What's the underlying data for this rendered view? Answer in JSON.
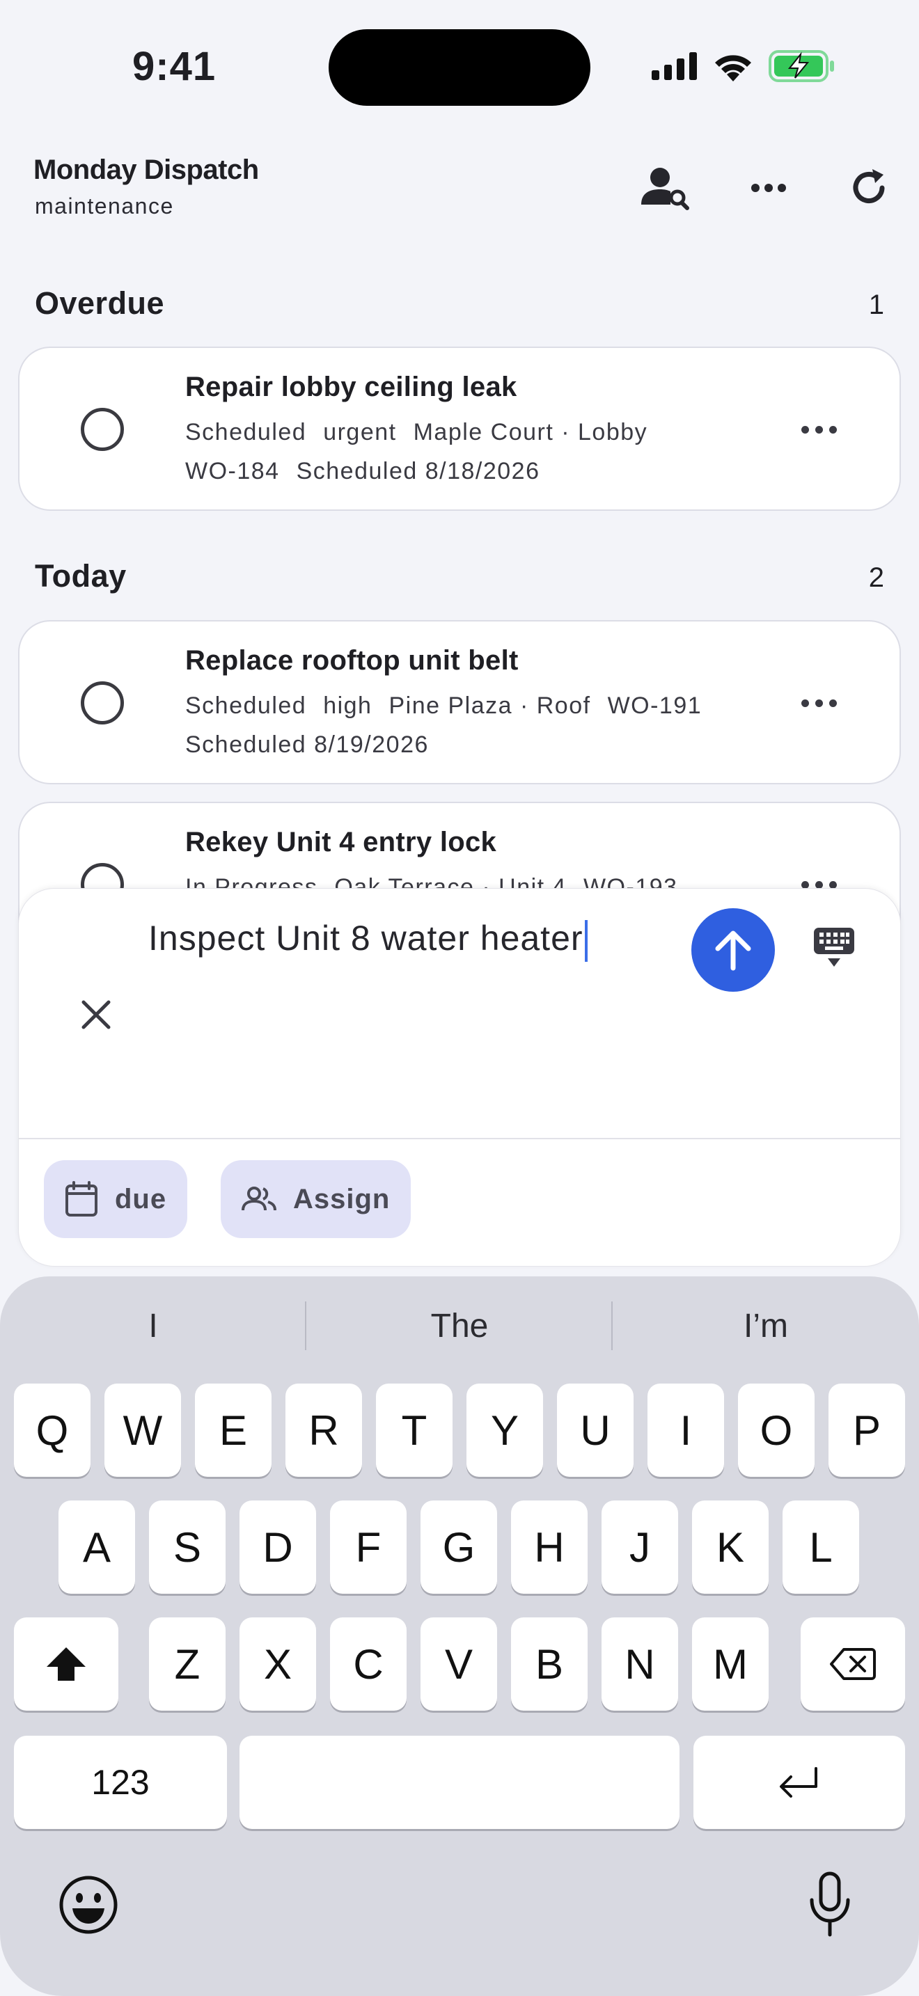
{
  "status_bar": {
    "time": "9:41"
  },
  "header": {
    "title": "Monday Dispatch",
    "subtitle": "maintenance",
    "icons": [
      "user-search-icon",
      "more-horizontal-icon",
      "refresh-icon"
    ]
  },
  "sections": [
    {
      "title": "Overdue",
      "count": "1",
      "items": [
        {
          "title": "Repair lobby ceiling leak",
          "meta_line1": [
            "Scheduled",
            "urgent",
            "Maple Court · Lobby"
          ],
          "meta_line2": [
            "WO-184",
            "Scheduled 8/18/2026"
          ]
        }
      ]
    },
    {
      "title": "Today",
      "count": "2",
      "items": [
        {
          "title": "Replace rooftop unit belt",
          "meta_line1": [
            "Scheduled",
            "high",
            "Pine Plaza · Roof",
            "WO-191"
          ],
          "meta_line2": [
            "Scheduled 8/19/2026"
          ]
        },
        {
          "title": "Rekey Unit 4 entry lock",
          "meta_line1": [
            "In Progress",
            "Oak Terrace · Unit 4",
            "WO-193"
          ],
          "meta_line2": []
        }
      ]
    }
  ],
  "composer": {
    "input_value": "Inspect Unit 8 water heater",
    "chips": [
      "due",
      "Assign"
    ],
    "accent_color": "#2f5fe0"
  },
  "keyboard": {
    "suggestions": [
      "I",
      "The",
      "I’m"
    ],
    "row1": [
      "Q",
      "W",
      "E",
      "R",
      "T",
      "Y",
      "U",
      "I",
      "O",
      "P"
    ],
    "row2": [
      "A",
      "S",
      "D",
      "F",
      "G",
      "H",
      "J",
      "K",
      "L"
    ],
    "row3": [
      "Z",
      "X",
      "C",
      "V",
      "B",
      "N",
      "M"
    ],
    "numbers_key": "123"
  }
}
